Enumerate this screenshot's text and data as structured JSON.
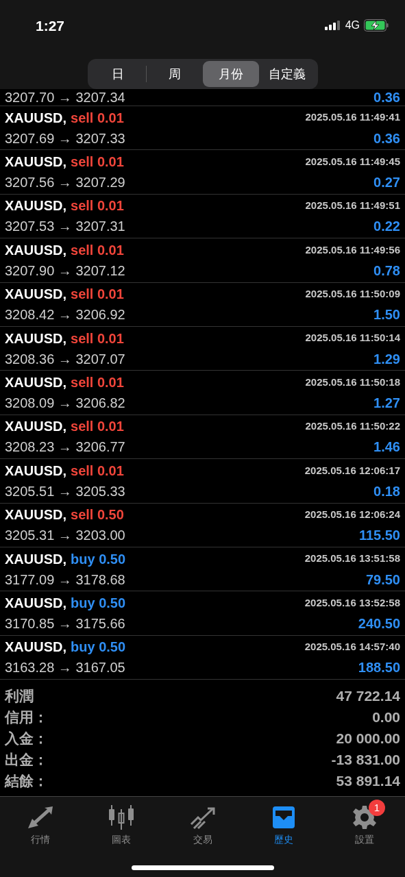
{
  "status_bar": {
    "time": "1:27",
    "network": "4G"
  },
  "segments": [
    {
      "label": "日",
      "selected": false
    },
    {
      "label": "周",
      "selected": false
    },
    {
      "label": "月份",
      "selected": true
    },
    {
      "label": "自定義",
      "selected": false
    }
  ],
  "partial_row": {
    "prices": "3207.70 → 3207.34",
    "profit": "0.36"
  },
  "trades": [
    {
      "symbol": "XAUUSD,",
      "order": "sell 0.01",
      "kind": "sell",
      "time": "2025.05.16 11:49:41",
      "prices": "3207.69 → 3207.33",
      "profit": "0.36"
    },
    {
      "symbol": "XAUUSD,",
      "order": "sell 0.01",
      "kind": "sell",
      "time": "2025.05.16 11:49:45",
      "prices": "3207.56 → 3207.29",
      "profit": "0.27"
    },
    {
      "symbol": "XAUUSD,",
      "order": "sell 0.01",
      "kind": "sell",
      "time": "2025.05.16 11:49:51",
      "prices": "3207.53 → 3207.31",
      "profit": "0.22"
    },
    {
      "symbol": "XAUUSD,",
      "order": "sell 0.01",
      "kind": "sell",
      "time": "2025.05.16 11:49:56",
      "prices": "3207.90 → 3207.12",
      "profit": "0.78"
    },
    {
      "symbol": "XAUUSD,",
      "order": "sell 0.01",
      "kind": "sell",
      "time": "2025.05.16 11:50:09",
      "prices": "3208.42 → 3206.92",
      "profit": "1.50"
    },
    {
      "symbol": "XAUUSD,",
      "order": "sell 0.01",
      "kind": "sell",
      "time": "2025.05.16 11:50:14",
      "prices": "3208.36 → 3207.07",
      "profit": "1.29"
    },
    {
      "symbol": "XAUUSD,",
      "order": "sell 0.01",
      "kind": "sell",
      "time": "2025.05.16 11:50:18",
      "prices": "3208.09 → 3206.82",
      "profit": "1.27"
    },
    {
      "symbol": "XAUUSD,",
      "order": "sell 0.01",
      "kind": "sell",
      "time": "2025.05.16 11:50:22",
      "prices": "3208.23 → 3206.77",
      "profit": "1.46"
    },
    {
      "symbol": "XAUUSD,",
      "order": "sell 0.01",
      "kind": "sell",
      "time": "2025.05.16 12:06:17",
      "prices": "3205.51 → 3205.33",
      "profit": "0.18"
    },
    {
      "symbol": "XAUUSD,",
      "order": "sell 0.50",
      "kind": "sell",
      "time": "2025.05.16 12:06:24",
      "prices": "3205.31 → 3203.00",
      "profit": "115.50"
    },
    {
      "symbol": "XAUUSD,",
      "order": "buy 0.50",
      "kind": "buy",
      "time": "2025.05.16 13:51:58",
      "prices": "3177.09 → 3178.68",
      "profit": "79.50"
    },
    {
      "symbol": "XAUUSD,",
      "order": "buy 0.50",
      "kind": "buy",
      "time": "2025.05.16 13:52:58",
      "prices": "3170.85 → 3175.66",
      "profit": "240.50"
    },
    {
      "symbol": "XAUUSD,",
      "order": "buy 0.50",
      "kind": "buy",
      "time": "2025.05.16 14:57:40",
      "prices": "3163.28 → 3167.05",
      "profit": "188.50"
    }
  ],
  "summary": [
    {
      "label": "利潤",
      "value": "47 722.14"
    },
    {
      "label": "信用：",
      "value": "0.00"
    },
    {
      "label": "入金：",
      "value": "20 000.00"
    },
    {
      "label": "出金：",
      "value": "-13 831.00"
    },
    {
      "label": "結餘：",
      "value": "53 891.14"
    }
  ],
  "tab_bar": [
    {
      "kind": "quotes",
      "label": "行情",
      "selected": false
    },
    {
      "kind": "chart",
      "label": "圖表",
      "selected": false
    },
    {
      "kind": "trade",
      "label": "交易",
      "selected": false
    },
    {
      "kind": "history",
      "label": "歷史",
      "selected": true
    },
    {
      "kind": "settings",
      "label": "設置",
      "selected": false,
      "badge": "1"
    }
  ]
}
